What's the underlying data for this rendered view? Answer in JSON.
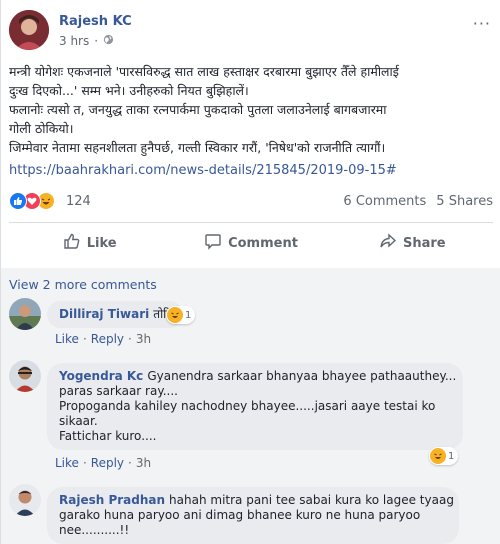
{
  "post": {
    "author": "Rajesh KC",
    "time": "3 hrs",
    "privacy_icon": "globe-icon",
    "menu": "···",
    "lines": [
      "मन्त्री योगेशः एकजनाले 'पारसविरुद्ध सात लाख हस्ताक्षर दरबारमा बुझाएर तैँले हामीलाई",
      "दुःख दिएको...' सम्म भने। उनीहरुको नियत बुझिहालें।",
      "फलानोः त्यसो त, जनयुद्ध ताका रत्नपार्कमा पुकदाको पुतला जलाउनेलाई बागबजारमा",
      "गोली ठोकियो।",
      "जिम्मेवार नेतामा सहनशीलता हुनैपर्छ, गल्ती स्विकार गरौं, 'निषेध'को राजनीति त्यागौं।"
    ],
    "link": "https://baahrakhari.com/news-details/215845/2019-09-15#",
    "reaction_count": "124",
    "comments_count": "6 Comments",
    "shares_count": "5 Shares"
  },
  "actions": {
    "like": "Like",
    "comment": "Comment",
    "share": "Share"
  },
  "comments_section": {
    "view_more": "View 2 more comments",
    "like_label": "Like",
    "reply_label": "Reply",
    "separator": "·",
    "comments": [
      {
        "name": "Dilliraj Tiwari",
        "text": "तोरि",
        "time": "3h",
        "haha_count": "1",
        "lines": []
      },
      {
        "name": "Yogendra Kc",
        "text": "Gyanendra sarkaar bhanyaa bhayee pathaauthey...",
        "lines": [
          "paras sarkaar ray....",
          "Propoganda kahiley nachodney bhayee.....jasari aaye testai ko",
          "sikaar.",
          "Fattichar kuro...."
        ],
        "time": "3h",
        "haha_count": "1"
      },
      {
        "name": "Rajesh Pradhan",
        "text": "hahah mitra pani tee sabai kura ko lagee tyaag",
        "lines": [
          "garako huna paryoo ani dimag bhanee kuro ne huna paryoo",
          "nee..........!!"
        ],
        "time": "",
        "haha_count": ""
      }
    ]
  },
  "colors": {
    "link": "#385898",
    "text": "#1d2129",
    "muted": "#616770",
    "like_blue": "#1877f2",
    "love_red": "#f33e58",
    "haha_yellow": "#f7b125",
    "bubble": "#e9ebee",
    "comments_bg": "#f2f3f5"
  }
}
